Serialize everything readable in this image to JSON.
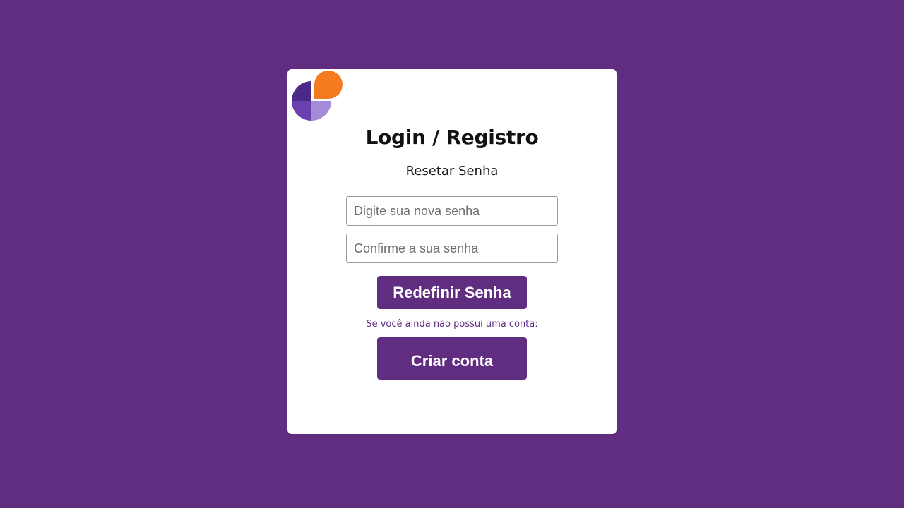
{
  "colors": {
    "background": "#612d80",
    "card": "#ffffff",
    "accent": "#612d80",
    "logo_orange": "#f47c1f",
    "logo_dark_purple": "#4a2a86",
    "logo_mid_purple": "#6a3fb0",
    "logo_light_purple": "#a38bd8"
  },
  "logo": {
    "icon": "brand-logo-icon"
  },
  "header": {
    "title": "Login / Registro",
    "subtitle": "Resetar Senha"
  },
  "form": {
    "new_password": {
      "placeholder": "Digite sua nova senha",
      "value": ""
    },
    "confirm_password": {
      "placeholder": "Confirme a sua senha",
      "value": ""
    },
    "submit_label": "Redefinir Senha"
  },
  "signup": {
    "hint": "Se você ainda não possui uma conta:",
    "button_label": "Criar conta"
  }
}
